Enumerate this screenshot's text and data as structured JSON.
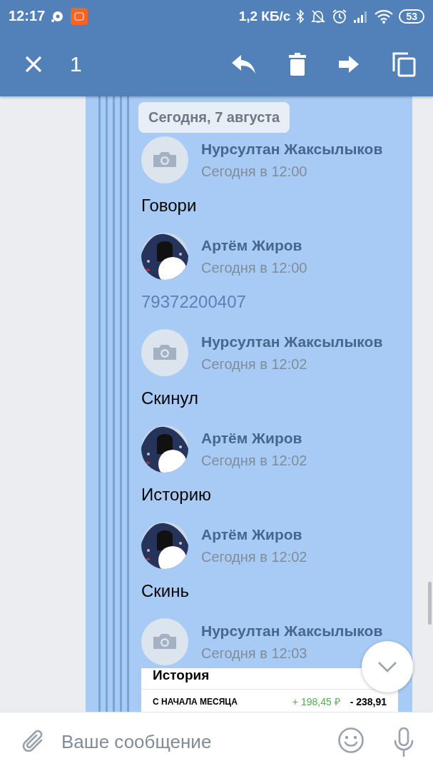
{
  "status_bar": {
    "time": "12:17",
    "network_speed": "1,2 КБ/с",
    "battery": "53"
  },
  "action_bar": {
    "selected_count": "1"
  },
  "forwarded_block": {
    "selected": true,
    "date": "Сегодня, 7 августа",
    "messages": [
      {
        "author": "Нурсултан Жаксылыков",
        "time": "Сегодня в 12:00",
        "avatar": {
          "kind": "camera"
        },
        "kind": "text",
        "text": "Говори"
      },
      {
        "author": "Артём Жиров",
        "time": "Сегодня в 12:00",
        "kind": "link",
        "text": "79372200407"
      },
      {
        "author": "Нурсултан Жаксылыков",
        "time": "Сегодня в 12:02",
        "avatar": {
          "kind": "camera"
        },
        "kind": "text",
        "text": "Скинул"
      },
      {
        "author": "Артём Жиров",
        "time": "Сегодня в 12:02",
        "kind": "text",
        "text": "Историю"
      },
      {
        "author": "Артём Жиров",
        "time": "Сегодня в 12:02",
        "kind": "text",
        "text": "Скинь"
      },
      {
        "author": "Нурсултан Жаксылыков",
        "time": "Сегодня в 12:03",
        "avatar": {
          "kind": "camera"
        },
        "kind": "screenshot",
        "screenshot": {
          "title": "История",
          "row_label": "С НАЧАЛА МЕСЯЦА",
          "income": "+ 198,45 ₽",
          "expense": "- 238,91"
        }
      }
    ]
  },
  "composer": {
    "placeholder": "Ваше сообщение"
  }
}
